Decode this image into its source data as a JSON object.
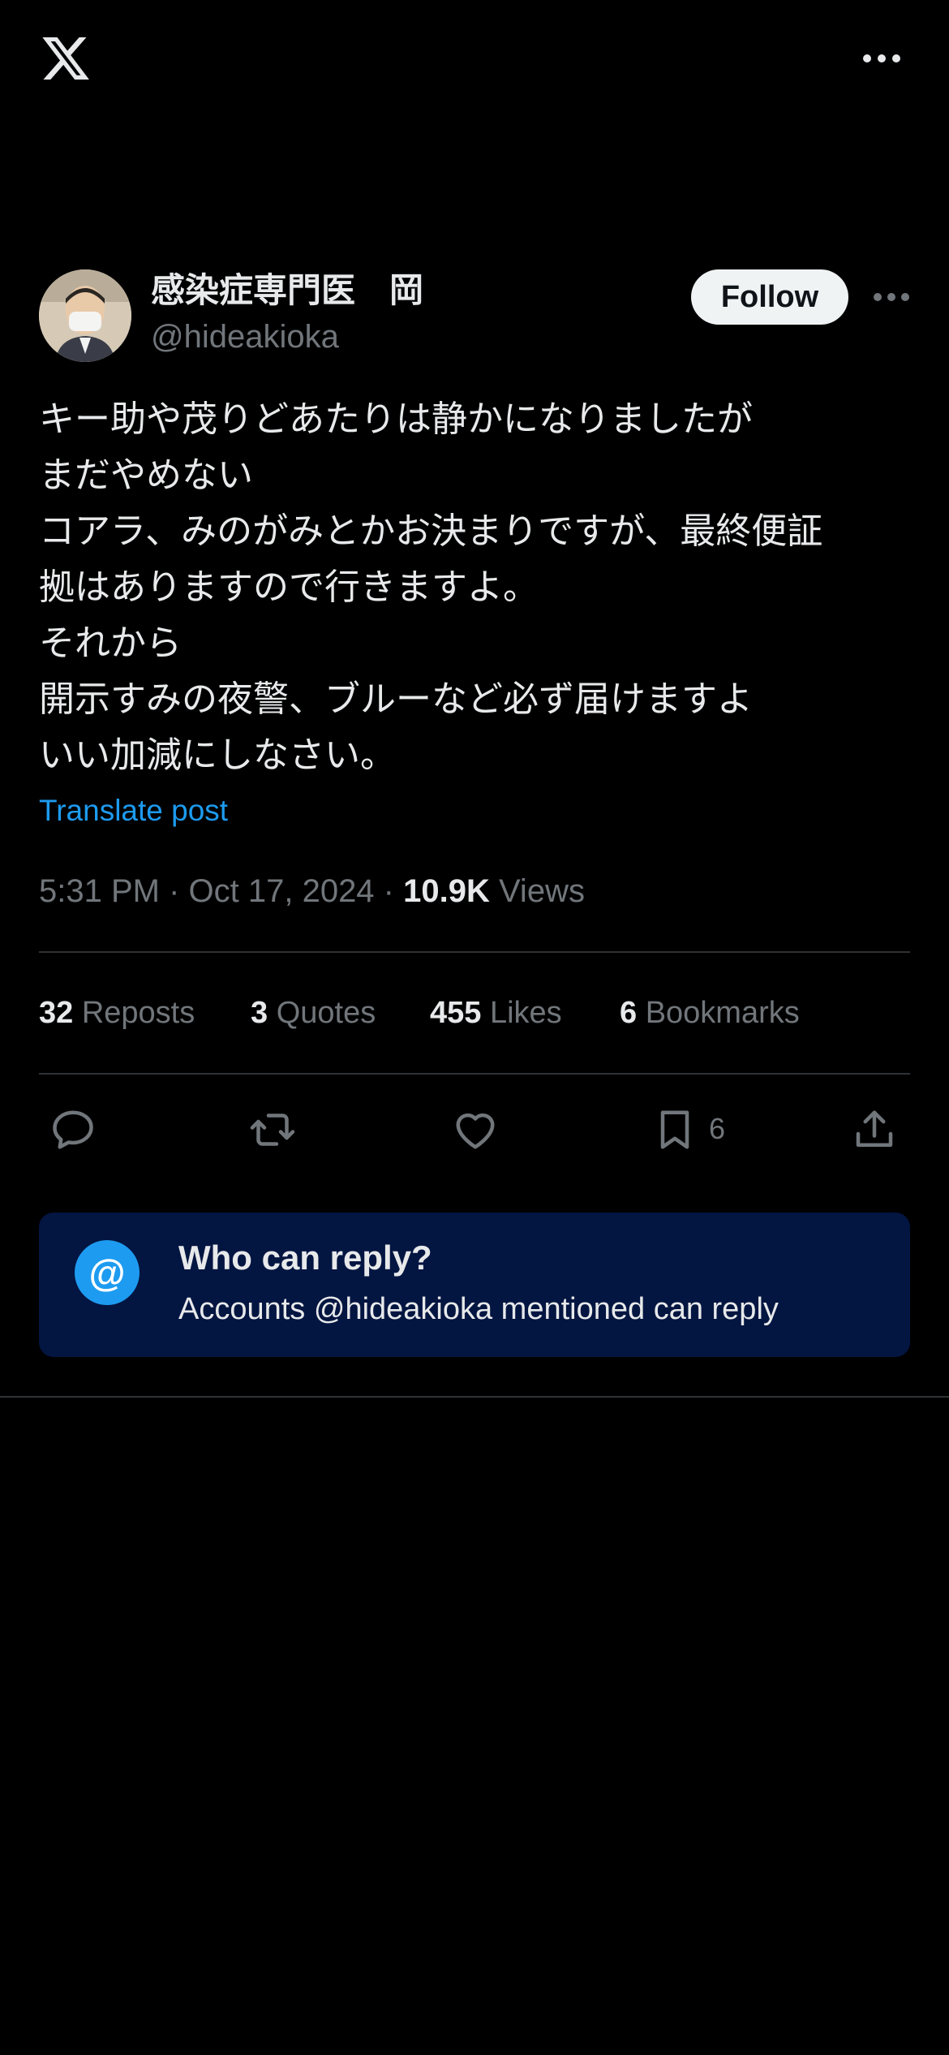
{
  "topbar": {
    "logo_icon": "x-logo-icon",
    "more_icon": "more-horizontal-icon"
  },
  "author": {
    "display_name": "感染症専門医　岡",
    "handle": "@hideakioka",
    "follow_label": "Follow"
  },
  "tweet": {
    "lines": [
      "キー助や茂りどあたりは静かになりましたが",
      "まだやめない",
      "コアラ、みのがみとかお決まりですが、最終便証",
      "拠はありますので行きますよ。",
      "それから",
      "開示すみの夜警、ブルーなど必ず届けますよ",
      "いい加減にしなさい。"
    ],
    "translate_label": "Translate post",
    "time": "5:31 PM · Oct 17, 2024 · ",
    "views_count": "10.9K",
    "views_label": " Views"
  },
  "stats": {
    "reposts_count": "32",
    "reposts_label": " Reposts",
    "quotes_count": "3",
    "quotes_label": " Quotes",
    "likes_count": "455",
    "likes_label": " Likes",
    "bookmarks_count": "6",
    "bookmarks_label": " Bookmarks"
  },
  "actions": {
    "bookmark_count": "6"
  },
  "reply_restriction": {
    "icon_glyph": "@",
    "title": "Who can reply?",
    "subtitle": "Accounts @hideakioka mentioned can reply"
  },
  "colors": {
    "background": "#000000",
    "accent": "#1d9bf0",
    "muted": "#71767b",
    "card": "#031541"
  }
}
